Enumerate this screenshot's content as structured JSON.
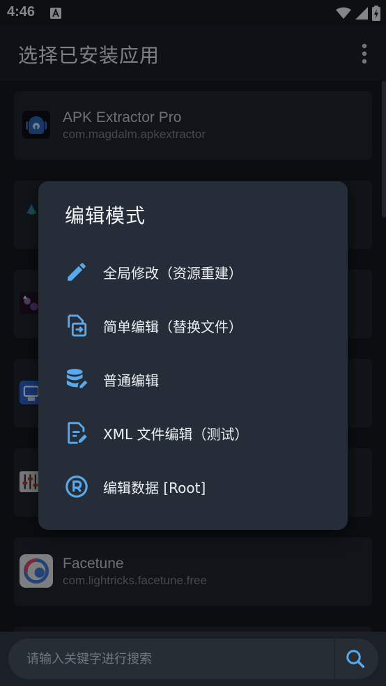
{
  "status": {
    "time": "4:46"
  },
  "appbar": {
    "title": "选择已安装应用"
  },
  "apps": [
    {
      "name": "APK Extractor Pro",
      "package": "com.magdalm.apkextractor"
    },
    {
      "name": "",
      "package": ""
    },
    {
      "name": "",
      "package": ""
    },
    {
      "name": "",
      "package": ""
    },
    {
      "name": "",
      "package": ""
    },
    {
      "name": "Facetune",
      "package": "com.lightricks.facetune.free"
    }
  ],
  "dialog": {
    "title": "编辑模式",
    "options": [
      {
        "label": "全局修改（资源重建）",
        "icon": "pencil-icon"
      },
      {
        "label": "简单编辑（替换文件）",
        "icon": "file-replace-icon"
      },
      {
        "label": "普通编辑",
        "icon": "database-edit-icon"
      },
      {
        "label": "XML 文件编辑（测试）",
        "icon": "file-edit-icon"
      },
      {
        "label": "编辑数据 [Root]",
        "icon": "registered-icon"
      }
    ]
  },
  "search": {
    "placeholder": "请输入关键字进行搜索"
  },
  "colors": {
    "accent": "#5aa9ec",
    "dialog_bg": "#252e38",
    "card_bg": "#1f252c"
  }
}
